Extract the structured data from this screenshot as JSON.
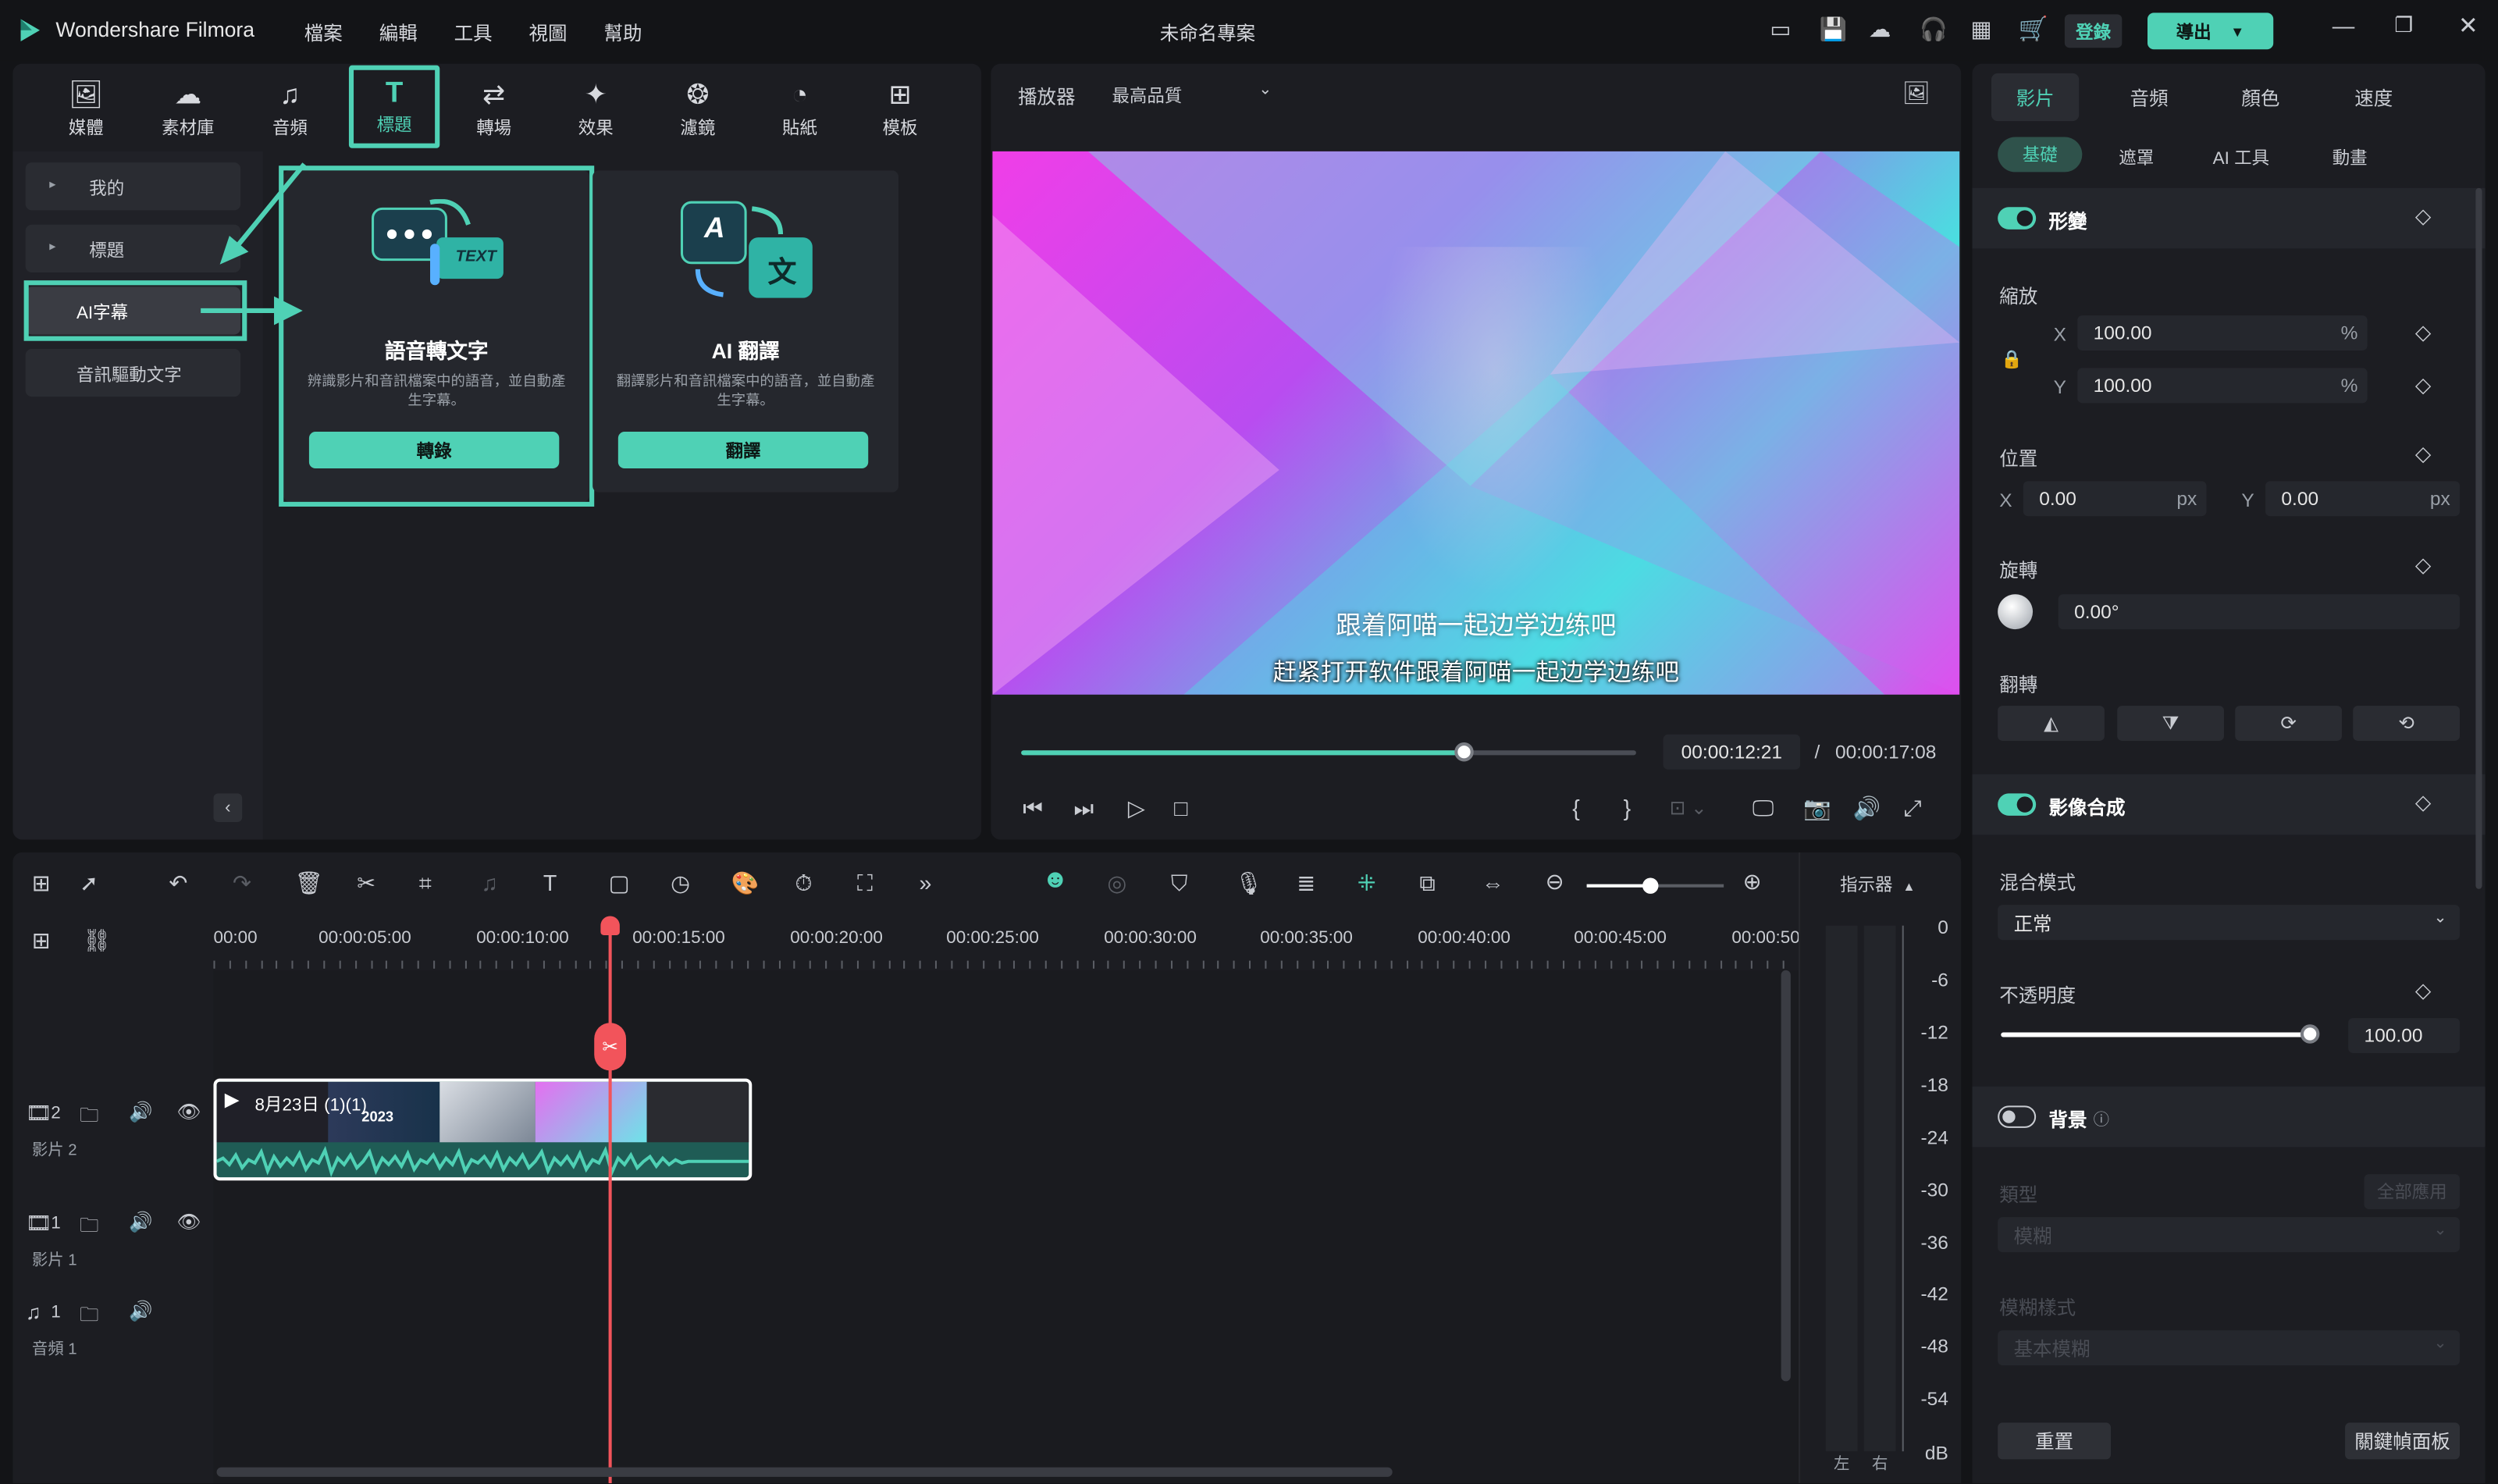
{
  "app": {
    "name": "Wondershare Filmora",
    "menu": [
      "檔案",
      "編輯",
      "工具",
      "視圖",
      "幫助"
    ],
    "project_title": "未命名專案",
    "login_label": "登錄",
    "export_label": "導出"
  },
  "toolbar_tabs": [
    {
      "label": "媒體",
      "icon": "media-icon"
    },
    {
      "label": "素材庫",
      "icon": "library-icon"
    },
    {
      "label": "音頻",
      "icon": "music-icon"
    },
    {
      "label": "標題",
      "icon": "title-icon"
    },
    {
      "label": "轉場",
      "icon": "transition-icon"
    },
    {
      "label": "效果",
      "icon": "effect-icon"
    },
    {
      "label": "濾鏡",
      "icon": "filter-icon"
    },
    {
      "label": "貼紙",
      "icon": "sticker-icon"
    },
    {
      "label": "模板",
      "icon": "template-icon"
    }
  ],
  "sidebar": {
    "items": [
      "我的",
      "標題",
      "AI字幕",
      "音訊驅動文字"
    ]
  },
  "cards": [
    {
      "title": "語音轉文字",
      "desc": "辨識影片和音訊檔案中的語音，並自動產生字幕。",
      "button": "轉錄",
      "art_text": "TEXT"
    },
    {
      "title": "AI 翻譯",
      "desc": "翻譯影片和音訊檔案中的語音，並自動產生字幕。",
      "button": "翻譯",
      "art_text_a": "A",
      "art_text_b": "文"
    }
  ],
  "player": {
    "label": "播放器",
    "quality": "最高品質",
    "subtitle_1": "跟着阿喵一起边学边练吧",
    "subtitle_2": "赶紧打开软件跟着阿喵一起边学边练吧",
    "current_time": "00:00:12:21",
    "separator": "/",
    "total_time": "00:00:17:08",
    "progress": 0.72
  },
  "right_panel": {
    "tabs": [
      "影片",
      "音頻",
      "顏色",
      "速度"
    ],
    "subtabs": [
      "基礎",
      "遮罩",
      "AI 工具",
      "動畫"
    ],
    "transform_label": "形變",
    "scale_label": "縮放",
    "scale_x_axis": "X",
    "scale_x": "100.00",
    "scale_y_axis": "Y",
    "scale_y": "100.00",
    "percent_unit": "%",
    "position_label": "位置",
    "pos_x_axis": "X",
    "pos_x": "0.00",
    "pos_y_axis": "Y",
    "pos_y": "0.00",
    "px_unit": "px",
    "rotate_label": "旋轉",
    "rotate_value": "0.00°",
    "flip_label": "翻轉",
    "composite_label": "影像合成",
    "blend_label": "混合模式",
    "blend_value": "正常",
    "opacity_label": "不透明度",
    "opacity_value": "100.00",
    "opacity_level": 1.0,
    "background_label": "背景",
    "type_label": "類型",
    "apply_all_label": "全部應用",
    "type_value": "模糊",
    "blur_style_label": "模糊樣式",
    "blur_style_value": "基本模糊",
    "reset_label": "重置",
    "keyframe_label": "關鍵幀面板"
  },
  "timeline": {
    "indicator_label": "指示器",
    "ruler": [
      "00:00",
      "00:00:05:00",
      "00:00:10:00",
      "00:00:15:00",
      "00:00:20:00",
      "00:00:25:00",
      "00:00:30:00",
      "00:00:35:00",
      "00:00:40:00",
      "00:00:45:00",
      "00:00:50"
    ],
    "tracks": [
      {
        "num": "2",
        "name": "影片 2"
      },
      {
        "num": "1",
        "name": "影片 1"
      },
      {
        "num": "1",
        "name": "音頻 1"
      }
    ],
    "clip_title": "8月23日 (1)(1)",
    "clip_overlay_text": "2023",
    "vu_scale": [
      "0",
      "-6",
      "-12",
      "-18",
      "-24",
      "-30",
      "-36",
      "-42",
      "-48",
      "-54"
    ],
    "vu_unit": "dB",
    "vu_left": "左",
    "vu_right": "右"
  },
  "colors": {
    "accent": "#4fd1b5",
    "playhead": "#f2545b",
    "panel": "#1c1d22",
    "background": "#131417"
  }
}
